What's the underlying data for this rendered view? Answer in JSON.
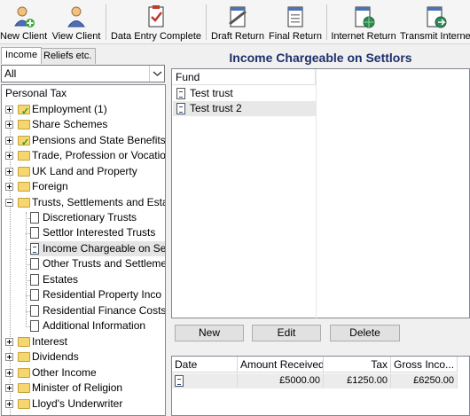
{
  "toolbar": {
    "new_client": "New Client",
    "view_client": "View Client",
    "data_entry_complete": "Data Entry Complete",
    "draft_return": "Draft Return",
    "final_return": "Final Return",
    "internet_return": "Internet Return",
    "transmit_internet": "Transmit Internet"
  },
  "tabs": {
    "income": "Income",
    "reliefs": "Reliefs etc."
  },
  "filter": {
    "selected": "All"
  },
  "tree": {
    "root": "Personal Tax",
    "items": [
      "Employment (1)",
      "Share Schemes",
      "Pensions and State Benefits (",
      "Trade, Profession or Vocatio",
      "UK Land and Property",
      "Foreign",
      "Trusts, Settlements and Estat",
      "Discretionary Trusts",
      "Settlor Interested Trusts",
      "Income Chargeable on Se",
      "Other Trusts and Settleme",
      "Estates",
      "Residential Property Inco",
      "Residential Finance Costs",
      "Additional Information",
      "Interest",
      "Dividends",
      "Other Income",
      "Minister of Religion",
      "Lloyd's Underwriter"
    ]
  },
  "page_title": "Income Chargeable on Settlors",
  "fund": {
    "header": "Fund",
    "rows": [
      "Test trust",
      "Test trust 2"
    ]
  },
  "buttons": {
    "new": "New",
    "edit": "Edit",
    "delete": "Delete"
  },
  "grid": {
    "headers": [
      "Date",
      "Amount Received",
      "Tax",
      "Gross Inco..."
    ],
    "rows": [
      {
        "date": "",
        "amount": "£5000.00",
        "tax": "£1250.00",
        "gross": "£6250.00"
      }
    ]
  },
  "colors": {
    "title": "#1e2f6b",
    "selection": "#e5e5e5"
  }
}
